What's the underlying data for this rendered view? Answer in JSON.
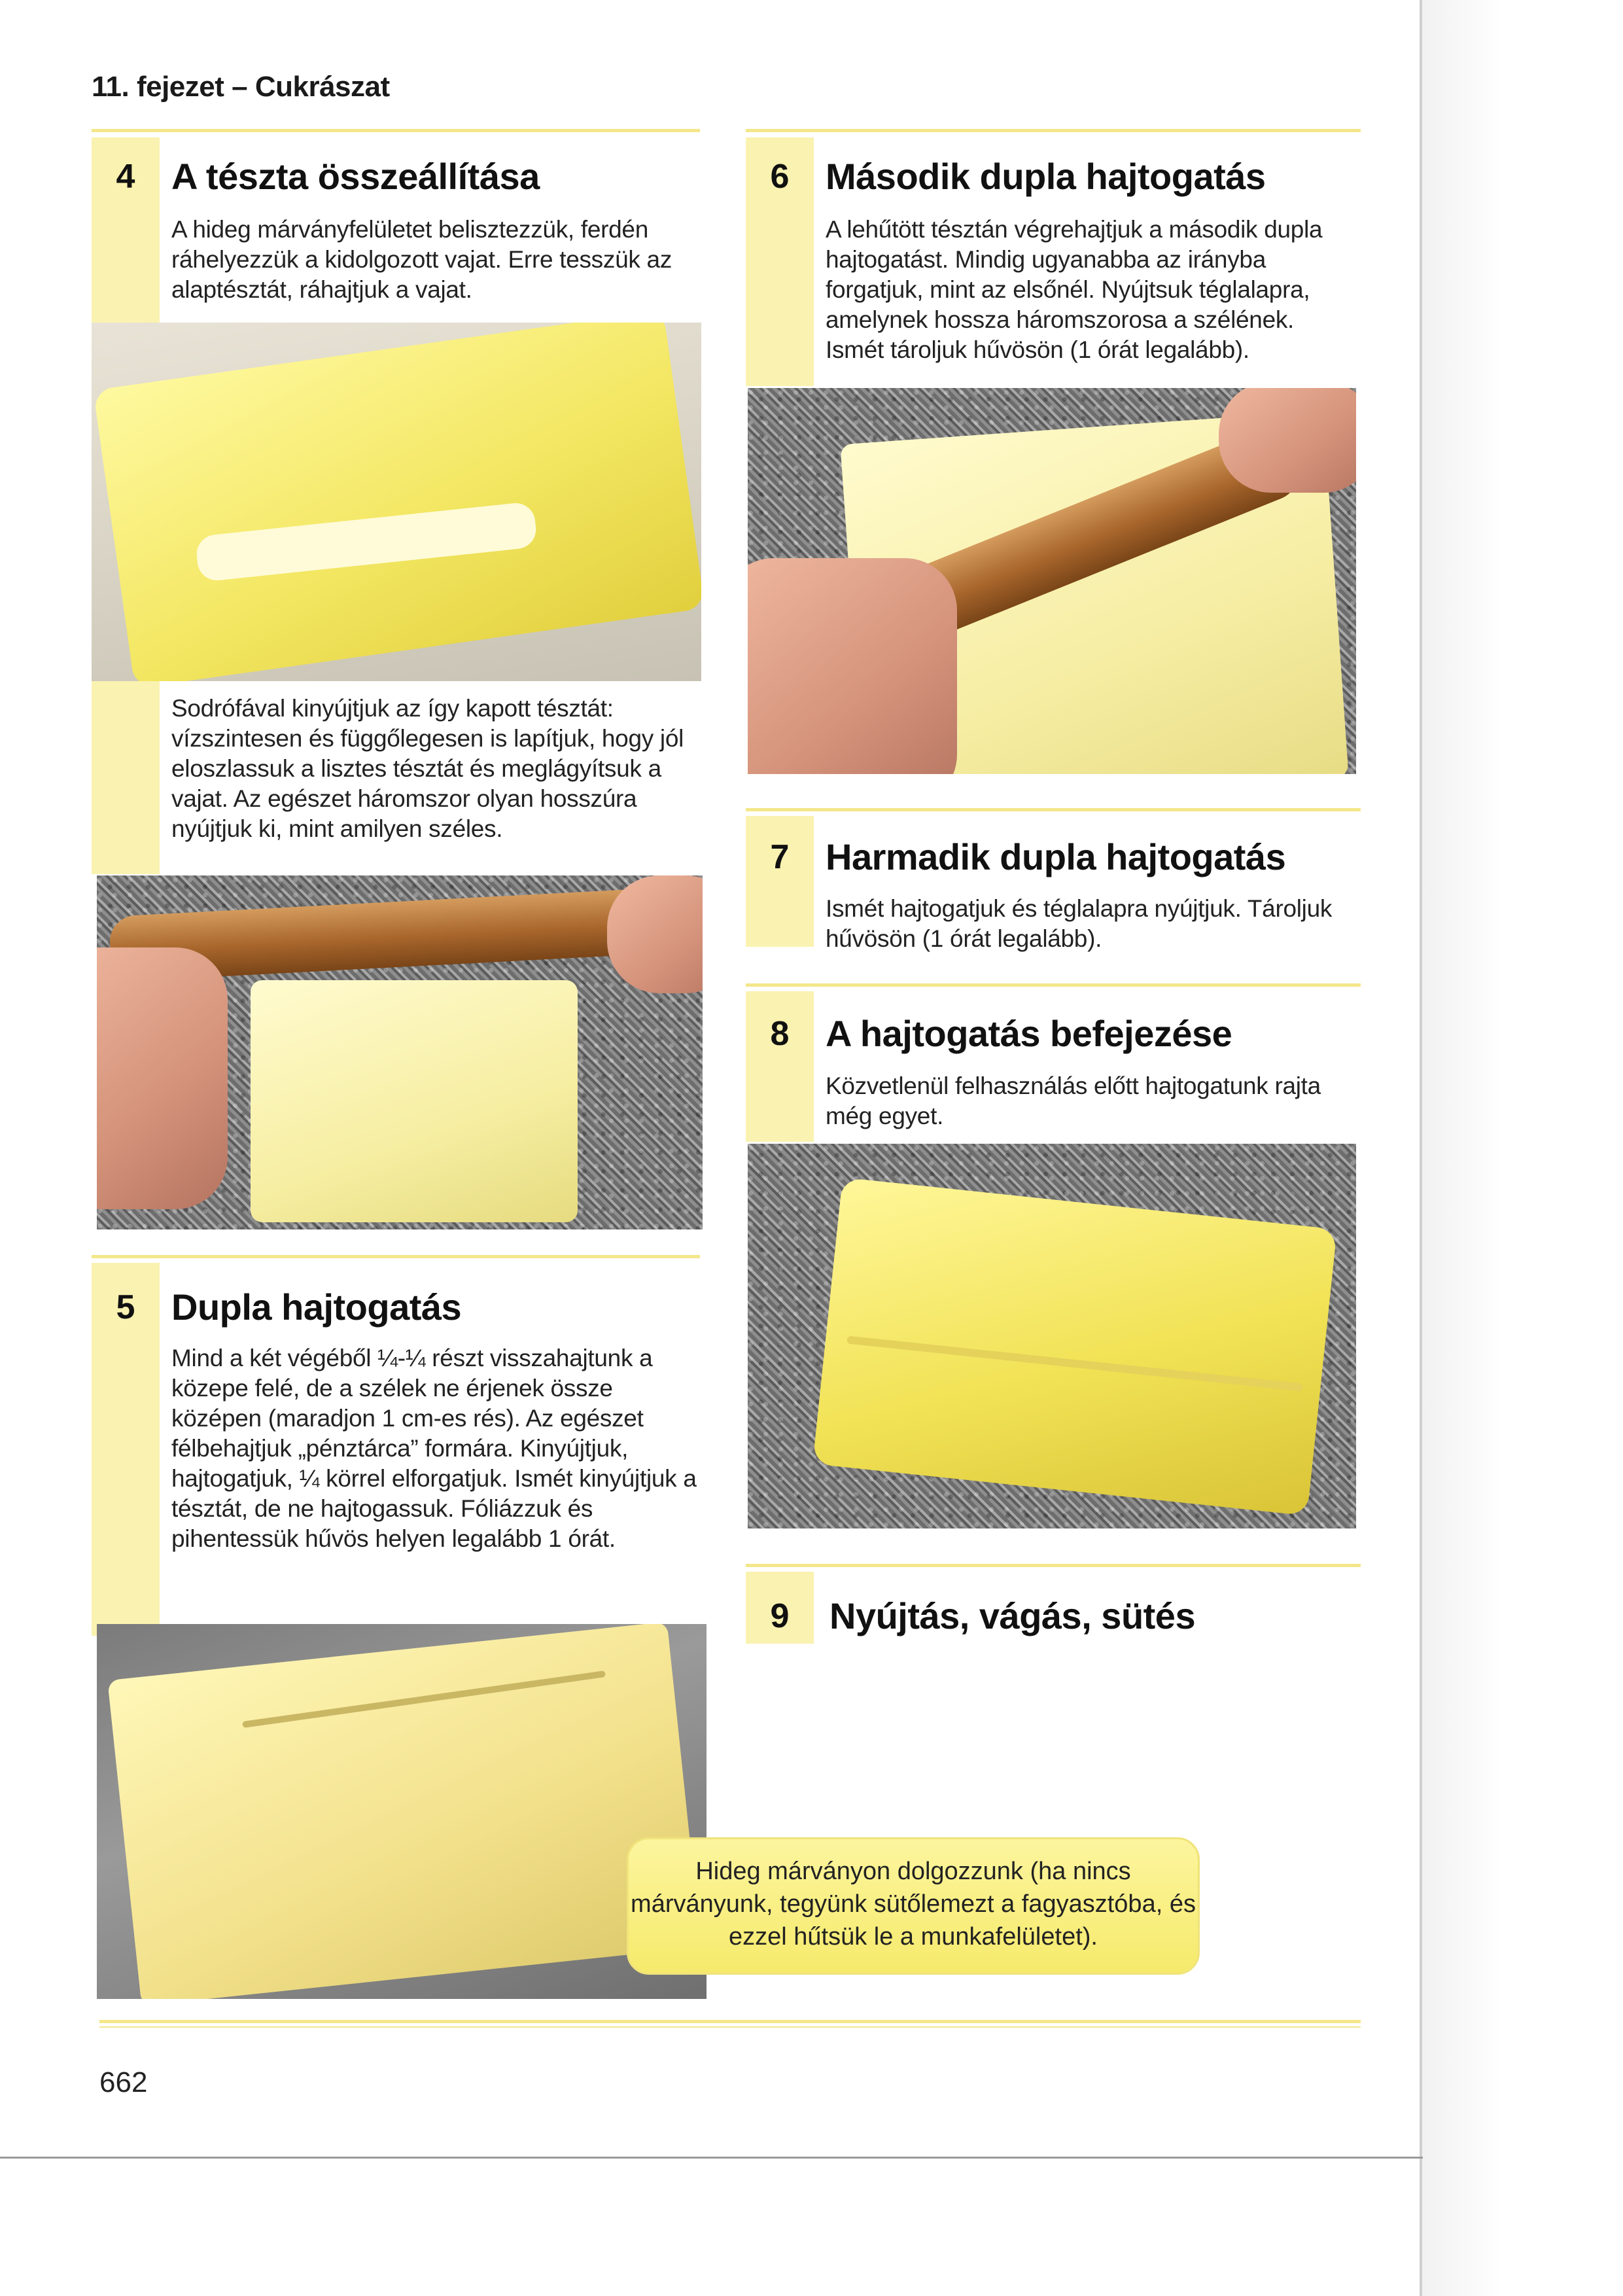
{
  "header": {
    "chapter": "11. fejezet – Cukrászat"
  },
  "sections": {
    "s4": {
      "number": "4",
      "title": "A tészta összeállítása",
      "text1": "A hideg márványfelületet belisztezzük, ferdén ráhelyezzük a kidolgozott vajat. Erre tesszük az alaptésztát, ráhajtjuk a vajat.",
      "text2": "Sodrófával kinyújtjuk az így kapott tésztát: vízszintesen és függőlegesen is lapítjuk, hogy jól eloszlassuk a lisztes tésztát és meglágyítsuk a vajat. Az egészet háromszor olyan hosszúra nyújtjuk ki, mint amilyen széles."
    },
    "s5": {
      "number": "5",
      "title": "Dupla hajtogatás",
      "text": "Mind a két végéből ¼-¼ részt visszahajtunk a közepe felé, de a szélek ne érjenek össze középen (maradjon 1 cm-es rés). Az egészet félbehajtjuk „pénztárca” formára. Kinyújtjuk, hajtogatjuk, ¼ körrel elforgatjuk. Ismét kinyújtjuk a tésztát, de ne hajtogassuk. Fóliázzuk és pihentessük hűvös helyen legalább 1 órát."
    },
    "s6": {
      "number": "6",
      "title": "Második dupla hajtogatás",
      "text": "A lehűtött tésztán végrehajtjuk a második dupla hajtogatást. Mindig ugyanabba az irányba forgatjuk, mint az elsőnél. Nyújtsuk téglalapra, amelynek hossza háromszorosa a szélének. Ismét tároljuk hűvösön (1 órát legalább)."
    },
    "s7": {
      "number": "7",
      "title": "Harmadik dupla hajtogatás",
      "text": "Ismét hajtogatjuk és téglalapra nyújtjuk. Tároljuk hűvösön (1 órát legalább)."
    },
    "s8": {
      "number": "8",
      "title": "A hajtogatás befejezése",
      "text": "Közvetlenül felhasználás előtt hajtogatunk rajta még egyet."
    },
    "s9": {
      "number": "9",
      "title": "Nyújtás, vágás, sütés"
    }
  },
  "note": {
    "text": "Hideg márványon dolgozzunk (ha nincs márványunk, tegyünk sütőlemezt a fagyasztóba, és ezzel hűtsük le a munkafelületet)."
  },
  "footer": {
    "page_number": "662"
  },
  "colors": {
    "accent_yellow": "#f4e78a",
    "stripe_yellow": "#faf2b0",
    "note_yellow": "#f6ea6c"
  }
}
